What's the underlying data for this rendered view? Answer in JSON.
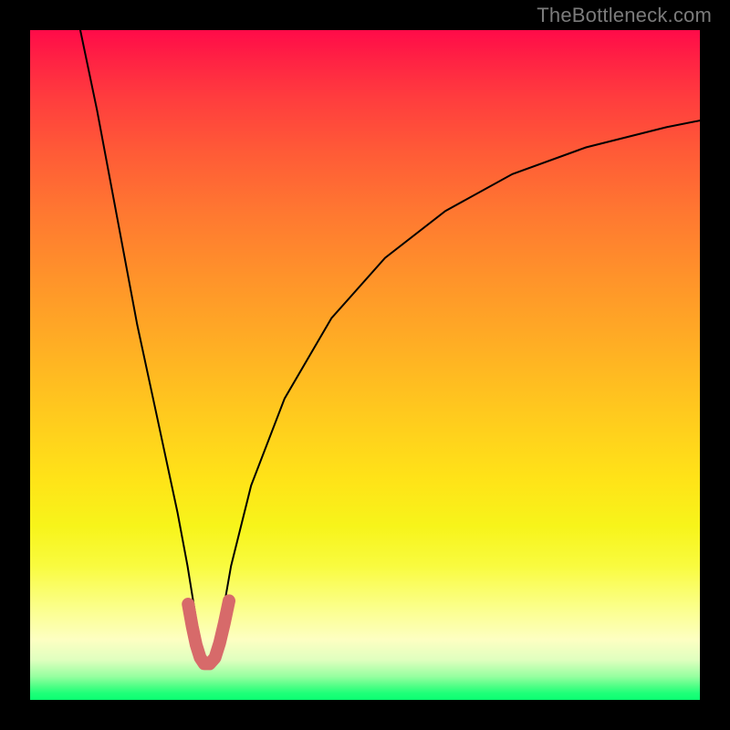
{
  "watermark": "TheBottleneck.com",
  "chart_data": {
    "type": "line",
    "title": "",
    "xlabel": "",
    "ylabel": "",
    "xlim": [
      0,
      100
    ],
    "ylim": [
      0,
      100
    ],
    "grid": false,
    "legend": false,
    "curve": {
      "minimum_x_percent": 26,
      "points_percent": [
        [
          7.5,
          100
        ],
        [
          10,
          88
        ],
        [
          13,
          72
        ],
        [
          16,
          56
        ],
        [
          19,
          42
        ],
        [
          22,
          28
        ],
        [
          23.5,
          20
        ],
        [
          24.8,
          12
        ],
        [
          25.5,
          7
        ],
        [
          26,
          5.3
        ],
        [
          27,
          5.3
        ],
        [
          27.8,
          7
        ],
        [
          28.6,
          12
        ],
        [
          30,
          20
        ],
        [
          33,
          32
        ],
        [
          38,
          45
        ],
        [
          45,
          57
        ],
        [
          53,
          66
        ],
        [
          62,
          73
        ],
        [
          72,
          78.5
        ],
        [
          83,
          82.5
        ],
        [
          95,
          85.5
        ],
        [
          100,
          86.5
        ]
      ]
    },
    "overlay_segment": {
      "color": "#d76a6a",
      "stroke_width_px": 14,
      "points_percent": [
        [
          23.6,
          14.3
        ],
        [
          24.2,
          11
        ],
        [
          24.8,
          8.2
        ],
        [
          25.4,
          6.3
        ],
        [
          26,
          5.4
        ],
        [
          26.8,
          5.4
        ],
        [
          27.6,
          6.3
        ],
        [
          28.3,
          8.5
        ],
        [
          29,
          11.5
        ],
        [
          29.7,
          14.8
        ]
      ]
    },
    "background_gradient_stops": [
      {
        "pos": 0.0,
        "color": "#ff0b49"
      },
      {
        "pos": 0.5,
        "color": "#ffb822"
      },
      {
        "pos": 0.8,
        "color": "#fcfc40"
      },
      {
        "pos": 1.0,
        "color": "#0bff72"
      }
    ]
  }
}
